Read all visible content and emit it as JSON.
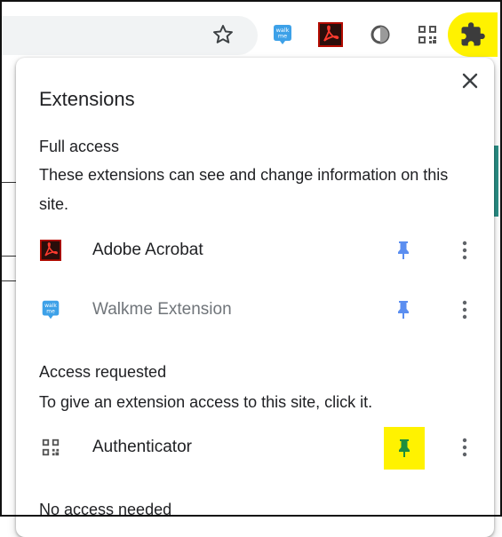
{
  "toolbar": {
    "icons": [
      "bookmark-star-icon",
      "walkme-icon",
      "adobe-acrobat-icon",
      "circle-extension-icon",
      "authenticator-qr-icon",
      "puzzle-extensions-icon"
    ],
    "walkme_badge": "walk me",
    "highlight_color": "#fff200"
  },
  "panel": {
    "title": "Extensions",
    "full_access": {
      "heading": "Full access",
      "description": "These extensions can see and change information on this site.",
      "items": [
        {
          "name": "Adobe Acrobat",
          "icon": "adobe-acrobat-icon",
          "pinned": true
        },
        {
          "name": "Walkme Extension",
          "icon": "walkme-icon",
          "pinned": true
        }
      ]
    },
    "access_requested": {
      "heading": "Access requested",
      "description": "To give an extension access to this site, click it.",
      "items": [
        {
          "name": "Authenticator",
          "icon": "authenticator-qr-icon",
          "pinned": true,
          "highlighted": true
        }
      ]
    },
    "no_access_needed": {
      "heading": "No access needed"
    }
  },
  "colors": {
    "pin_blue": "#5b8ef0",
    "pin_green": "#1e8e3e",
    "acrobat_red": "#b30b00",
    "walkme_blue": "#3da1e8"
  }
}
